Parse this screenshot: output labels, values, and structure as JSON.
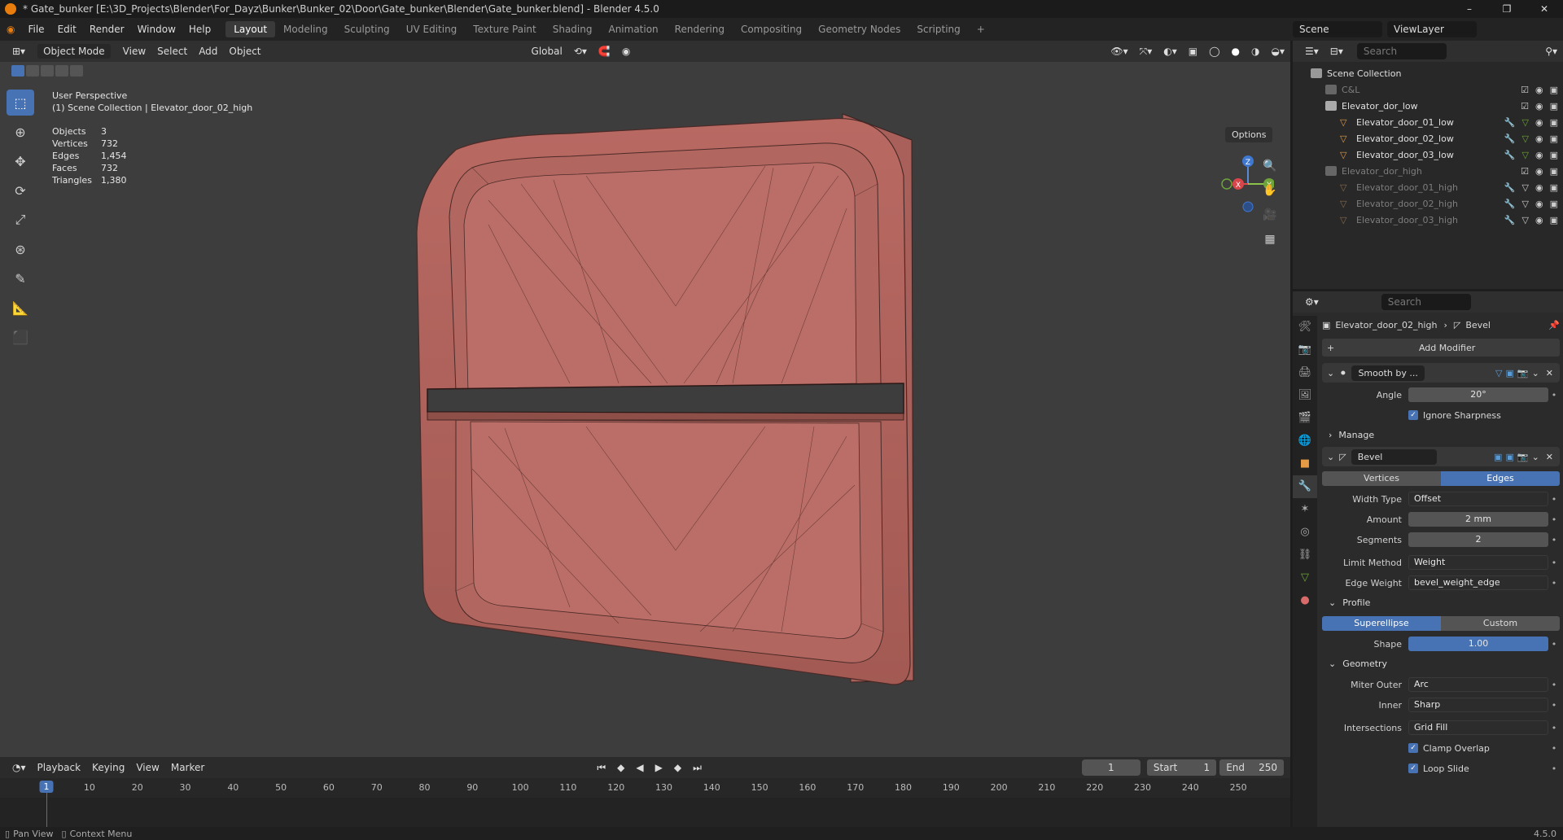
{
  "window": {
    "title": "* Gate_bunker [E:\\3D_Projects\\Blender\\For_Dayz\\Bunker\\Bunker_02\\Door\\Gate_bunker\\Blender\\Gate_bunker.blend] - Blender 4.5.0"
  },
  "menu": [
    "File",
    "Edit",
    "Render",
    "Window",
    "Help"
  ],
  "workspaces": [
    "Layout",
    "Modeling",
    "Sculpting",
    "UV Editing",
    "Texture Paint",
    "Shading",
    "Animation",
    "Rendering",
    "Compositing",
    "Geometry Nodes",
    "Scripting"
  ],
  "scene": {
    "name": "Scene",
    "view_layer": "ViewLayer"
  },
  "viewport_header": {
    "mode": "Object Mode",
    "menus": [
      "View",
      "Select",
      "Add",
      "Object"
    ],
    "orientation": "Global",
    "options": "Options"
  },
  "overlay": {
    "perspective": "User Perspective",
    "context": "(1) Scene Collection | Elevator_door_02_high",
    "stats": [
      {
        "label": "Objects",
        "value": "3"
      },
      {
        "label": "Vertices",
        "value": "732"
      },
      {
        "label": "Edges",
        "value": "1,454"
      },
      {
        "label": "Faces",
        "value": "732"
      },
      {
        "label": "Triangles",
        "value": "1,380"
      }
    ]
  },
  "gizmo": {
    "x": "X",
    "y": "Y",
    "z": "Z"
  },
  "timeline": {
    "menus": [
      "Playback",
      "Keying",
      "View",
      "Marker"
    ],
    "current_frame": "1",
    "start_label": "Start",
    "start": "1",
    "end_label": "End",
    "end": "250",
    "ticks": [
      "1",
      "10",
      "20",
      "30",
      "40",
      "50",
      "60",
      "70",
      "80",
      "90",
      "100",
      "110",
      "120",
      "130",
      "140",
      "150",
      "160",
      "170",
      "180",
      "190",
      "200",
      "210",
      "220",
      "230",
      "240",
      "250"
    ]
  },
  "statusbar": {
    "left": [
      "Pan View",
      "Context Menu"
    ],
    "version": "4.5.0"
  },
  "outliner": {
    "search_placeholder": "Search",
    "root": "Scene Collection",
    "rows": [
      {
        "label": "C&L",
        "dim": true
      },
      {
        "label": "Elevator_dor_low",
        "dim": false
      },
      {
        "label": "Elevator_door_01_low",
        "dim": false
      },
      {
        "label": "Elevator_door_02_low",
        "dim": false
      },
      {
        "label": "Elevator_door_03_low",
        "dim": false
      },
      {
        "label": "Elevator_dor_high",
        "dim": true
      },
      {
        "label": "Elevator_door_01_high",
        "dim": true
      },
      {
        "label": "Elevator_door_02_high",
        "dim": true
      },
      {
        "label": "Elevator_door_03_high",
        "dim": true
      }
    ]
  },
  "properties": {
    "search_placeholder": "Search",
    "object": "Elevator_door_02_high",
    "modifier_crumb": "Bevel",
    "add_modifier": "Add Modifier",
    "smooth": {
      "name": "Smooth by ...",
      "angle_label": "Angle",
      "angle": "20°",
      "ignore_sharpness": "Ignore Sharpness",
      "manage": "Manage"
    },
    "bevel": {
      "name": "Bevel",
      "mode_vertices": "Vertices",
      "mode_edges": "Edges",
      "width_type_label": "Width Type",
      "width_type": "Offset",
      "amount_label": "Amount",
      "amount": "2 mm",
      "segments_label": "Segments",
      "segments": "2",
      "limit_method_label": "Limit Method",
      "limit_method": "Weight",
      "edge_weight_label": "Edge Weight",
      "edge_weight": "bevel_weight_edge",
      "profile_label": "Profile",
      "profile_superellipse": "Superellipse",
      "profile_custom": "Custom",
      "shape_label": "Shape",
      "shape": "1.00",
      "geometry_label": "Geometry",
      "miter_outer_label": "Miter Outer",
      "miter_outer": "Arc",
      "inner_label": "Inner",
      "inner": "Sharp",
      "intersections_label": "Intersections",
      "intersections": "Grid Fill",
      "clamp_overlap": "Clamp Overlap",
      "loop_slide": "Loop Slide"
    }
  }
}
